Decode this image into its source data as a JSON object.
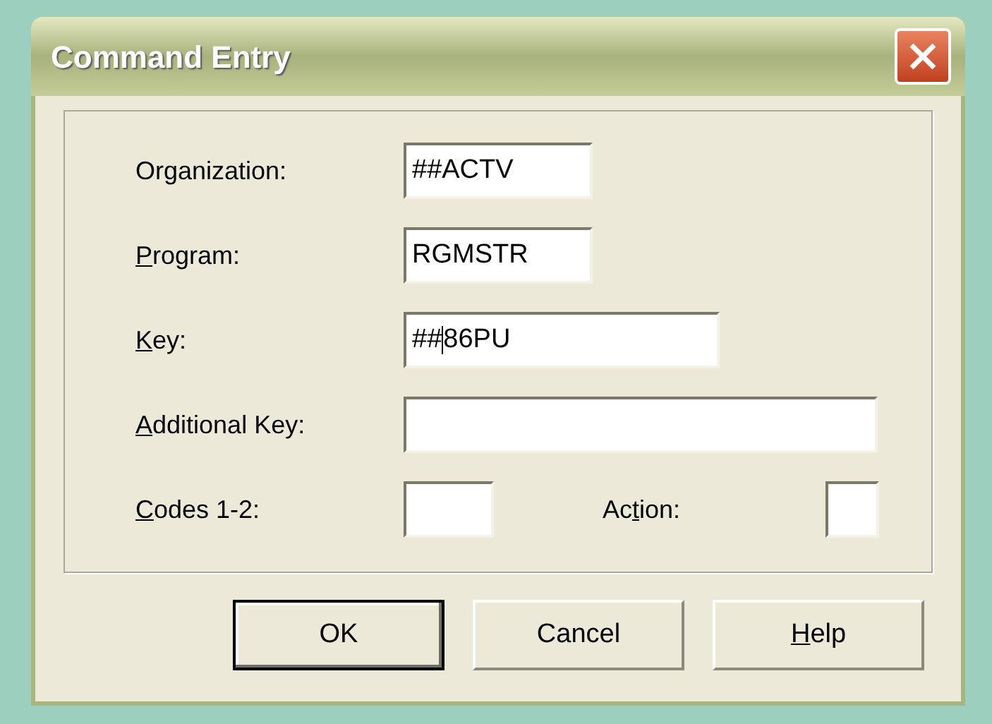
{
  "window": {
    "title": "Command Entry"
  },
  "fields": [
    {
      "label": {
        "after": "Organization:"
      },
      "value": "##ACTV",
      "focused": false
    },
    {
      "label": {
        "key": "P",
        "after": "rogram:"
      },
      "value": "RGMSTR",
      "focused": false
    },
    {
      "label": {
        "key": "K",
        "after": "ey:"
      },
      "value": "##",
      "value_after_caret": "86PU",
      "focused": true
    },
    {
      "label": {
        "key": "A",
        "after": "dditional Key:"
      },
      "focused": false
    }
  ],
  "codes": {
    "label": {
      "key": "C",
      "after": "odes 1-2:"
    }
  },
  "action": {
    "label": {
      "before": "Ac",
      "key": "t",
      "after": "ion:"
    }
  },
  "buttons": [
    {
      "label": {
        "after": "OK"
      },
      "default": true
    },
    {
      "label": {
        "after": "Cancel"
      },
      "default": false
    },
    {
      "label": {
        "key": "H",
        "after": "elp"
      },
      "default": false
    }
  ]
}
